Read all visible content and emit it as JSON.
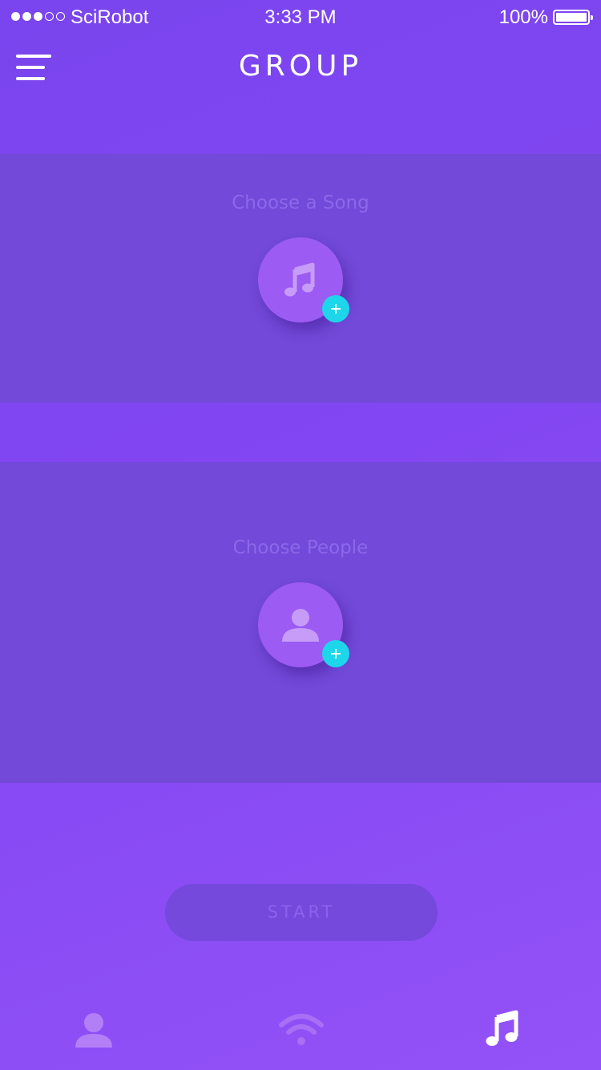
{
  "status_bar": {
    "signal_bars_filled": 3,
    "signal_bars_total": 5,
    "carrier": "SciRobot",
    "time": "3:33 PM",
    "battery_percent": "100%"
  },
  "header": {
    "menu_icon": "hamburger-menu-icon",
    "title": "GROUP"
  },
  "song_panel": {
    "label": "Choose a Song",
    "icon": "music-note-icon",
    "add_icon": "plus-icon"
  },
  "people_panel": {
    "label": "Choose People",
    "icon": "person-icon",
    "add_icon": "plus-icon"
  },
  "start_button": {
    "label": "START"
  },
  "tab_bar": {
    "tabs": [
      {
        "icon": "person-icon",
        "active": false
      },
      {
        "icon": "wifi-icon",
        "active": false
      },
      {
        "icon": "music-note-icon",
        "active": true
      }
    ]
  },
  "colors": {
    "background": "#8246f2",
    "panel": "#7249d8",
    "circle": "#9c5bf2",
    "accent_plus": "#1ed6ea",
    "muted_text": "#8c68ea"
  }
}
